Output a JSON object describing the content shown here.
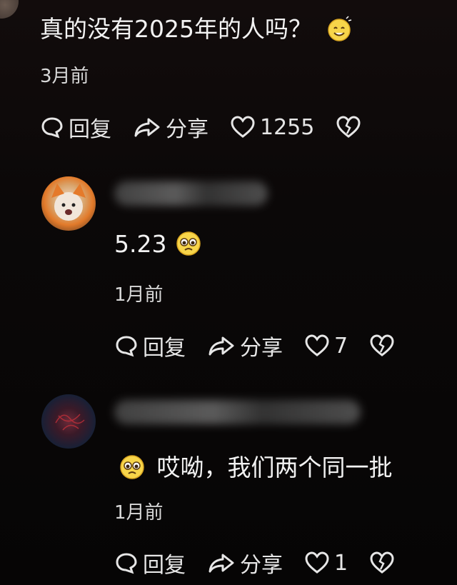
{
  "main": {
    "comment": "真的没有2025年的人吗？",
    "time": "3月前",
    "reply_label": "回复",
    "share_label": "分享",
    "like_count": "1255"
  },
  "replies": [
    {
      "text": "5.23",
      "time": "1月前",
      "reply_label": "回复",
      "share_label": "分享",
      "like_count": "7"
    },
    {
      "text": "哎呦，我们两个同一批",
      "time": "1月前",
      "reply_label": "回复",
      "share_label": "分享",
      "like_count": "1"
    }
  ],
  "colors": {
    "background": "#0a0707",
    "text": "#eeeeee",
    "emoji_yellow": "#f7d54a"
  },
  "icons": [
    "smile-emoji-icon",
    "pleading-emoji-icon",
    "comment-bubble-icon",
    "share-arrow-icon",
    "heart-icon",
    "broken-heart-icon"
  ]
}
